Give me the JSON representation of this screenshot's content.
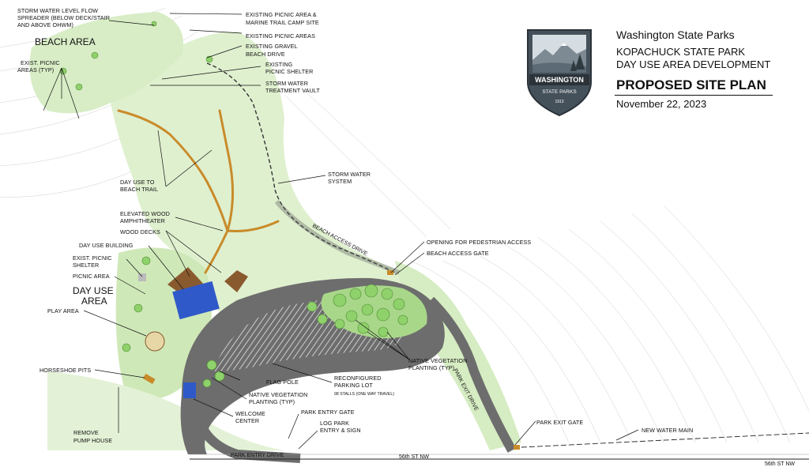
{
  "title_block": {
    "organization": "Washington State Parks",
    "park": "KOPACHUCK STATE PARK",
    "project": "DAY USE AREA DEVELOPMENT",
    "title": "PROPOSED SITE PLAN",
    "date": "November 22, 2023"
  },
  "logo": {
    "name": "WASHINGTON",
    "subtitle": "STATE PARKS",
    "year": "1913"
  },
  "area_labels": {
    "beach_area": "BEACH AREA",
    "day_use_line1": "DAY USE",
    "day_use_line2": "AREA"
  },
  "callouts": {
    "storm_spreader": [
      "STORM WATER LEVEL FLOW",
      "SPREADER  (BELOW DECK/STAIR",
      "AND ABOVE OHWM)"
    ],
    "exist_picnic_areas_typ": [
      "EXIST. PICNIC",
      "AREAS (TYP)"
    ],
    "picnic_marine_trail": [
      "EXISTING PICNIC AREA &",
      "MARINE TRAIL CAMP SITE"
    ],
    "existing_picnic_areas": [
      "EXISTING PICNIC AREAS"
    ],
    "gravel_beach_drive": [
      "EXISTING GRAVEL",
      "BEACH DRIVE"
    ],
    "existing_picnic_shelter": [
      "EXISTING",
      "PICNIC SHELTER"
    ],
    "treatment_vault": [
      "STORM WATER",
      "TREATMENT VAULT"
    ],
    "day_use_trail": [
      "DAY USE TO",
      "BEACH TRAIL"
    ],
    "storm_system": [
      "STORM WATER",
      "SYSTEM"
    ],
    "amphitheater": [
      "ELEVATED WOOD",
      "AMPHITHEATER"
    ],
    "wood_decks": [
      "WOOD DECKS"
    ],
    "day_use_building": [
      "DAY USE BUILDING"
    ],
    "exist_picnic_shelter": [
      "EXIST. PICNIC",
      "SHELTER"
    ],
    "picnic_area": [
      "PICNIC AREA"
    ],
    "play_area": [
      "PLAY AREA"
    ],
    "horseshoe_pits": [
      "HORSESHOE PITS"
    ],
    "pedestrian_opening": [
      "OPENING FOR PEDESTRIAN ACCESS"
    ],
    "beach_access_gate": [
      "BEACH ACCESS GATE"
    ],
    "native_veg_right": [
      "NATIVE VEGETATION",
      "PLANTING (TYP)"
    ],
    "reconfigured_lot": [
      "RECONFIGURED",
      "PARKING LOT"
    ],
    "stalls_note": "98 STALLS (ONE WAY TRAVEL)",
    "flag_pole": [
      "FLAG POLE"
    ],
    "native_veg_left": [
      "NATIVE VEGETATION",
      "PLANTING (TYP)"
    ],
    "welcome_center": [
      "WELCOME",
      "CENTER"
    ],
    "park_entry_gate": [
      "PARK ENTRY GATE"
    ],
    "log_park_entry": [
      "LOG PARK",
      "ENTRY & SIGN"
    ],
    "remove_pump_house": [
      "REMOVE",
      "PUMP HOUSE"
    ],
    "park_exit_gate": [
      "PARK EXIT GATE"
    ],
    "new_water_main": [
      "NEW WATER MAIN"
    ]
  },
  "road_labels": {
    "beach_access_drive": "BEACH ACCESS DRIVE",
    "park_exit_drive": "PARK EXIT DRIVE",
    "park_entry_drive": "PARK ENTRY DRIVE",
    "street_main": "56th ST NW",
    "street_right": "56th ST NW"
  },
  "colors": {
    "vegetation": "#cfe8b8",
    "vegetation_dark": "#a9d78a",
    "tree_canopy": "#8fd16a",
    "pavement": "#6d6d6d",
    "building_roof": "#2f59c9",
    "wood_deck": "#8a5a2f",
    "trail": "#c98b2a"
  }
}
